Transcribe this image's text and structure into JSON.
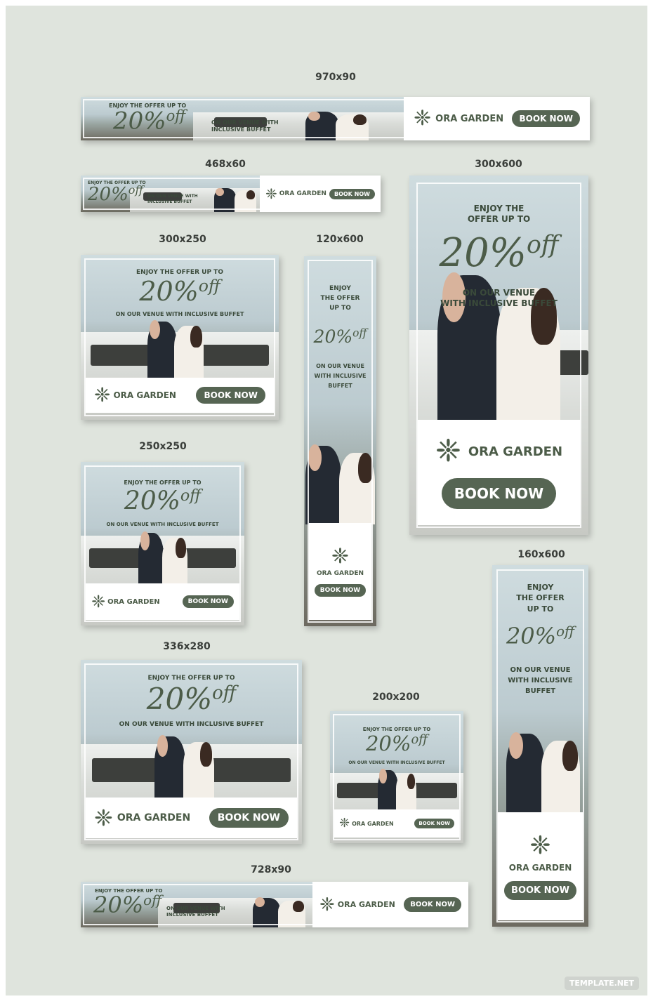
{
  "sizes": {
    "s970x90": "970x90",
    "s468x60": "468x60",
    "s300x600": "300x600",
    "s300x250": "300x250",
    "s120x600": "120x600",
    "s250x250": "250x250",
    "s160x600": "160x600",
    "s336x280": "336x280",
    "s200x200": "200x200",
    "s728x90": "728x90"
  },
  "ad": {
    "enjoy_line": "ENJOY THE OFFER UP TO",
    "enjoy_a": "ENJOY THE",
    "enjoy_b": "OFFER UP TO",
    "enjoy_c": "ENJOY",
    "enjoy_d": "THE OFFER",
    "enjoy_e": "UP TO",
    "offer_pct": "20%",
    "offer_off": "off",
    "venue_line": "ON OUR VENUE WITH INCLUSIVE BUFFET",
    "venue_a": "ON OUR VENUE",
    "venue_b": "WITH INCLUSIVE BUFFET",
    "venue_c": "ON OUR VENUE WITH",
    "venue_d": "INCLUSIVE BUFFET",
    "venue_e": "WITH INCLUSIVE",
    "venue_f": "BUFFET",
    "brand": "ORA GARDEN",
    "cta": "BOOK NOW"
  },
  "icons": {
    "logo": "flower-ornament-icon"
  },
  "colors": {
    "accent": "#566553",
    "text": "#4c5c48",
    "background": "#dfe4dd"
  },
  "watermark": "TEMPLATE.NET"
}
